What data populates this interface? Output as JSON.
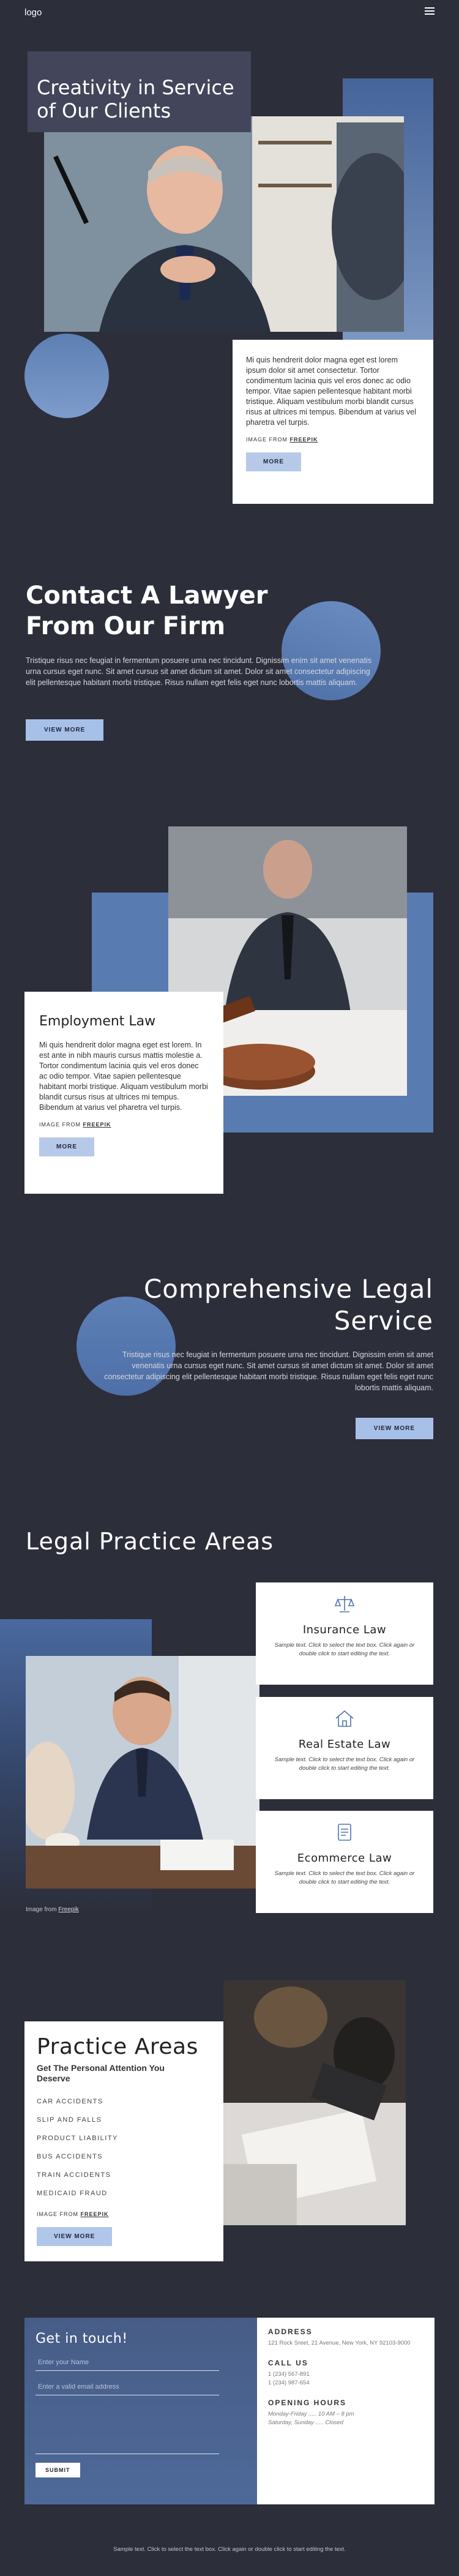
{
  "header": {
    "logo": "logo",
    "menu_icon": "hamburger-icon"
  },
  "hero": {
    "title": "Creativity in Service of Our Clients",
    "body": "Mi quis hendrerit dolor magna eget est lorem ipsum dolor sit amet consectetur. Tortor condimentum lacinia quis vel eros donec ac odio tempor. Vitae sapien pellentesque habitant morbi tristique. Aliquam vestibulum morbi blandit cursus risus at ultrices mi tempus. Bibendum at varius vel pharetra vel turpis.",
    "credit_prefix": "Image from",
    "credit_link": "Freepik",
    "button": "MORE"
  },
  "contact": {
    "title": "Contact A Lawyer From Our Firm",
    "body": "Tristique risus nec feugiat in fermentum posuere urna nec tincidunt. Dignissim enim sit amet venenatis urna cursus eget nunc. Sit amet cursus sit amet dictum sit amet. Dolor sit amet consectetur adipiscing elit pellentesque habitant morbi tristique. Risus nullam eget felis eget nunc lobortis mattis aliquam.",
    "button": "VIEW MORE"
  },
  "employment": {
    "title": "Employment Law",
    "body": "Mi quis hendrerit dolor magna eget est lorem. In est ante in nibh mauris cursus mattis molestie a. Tortor condimentum lacinia quis vel eros donec ac odio tempor. Vitae sapien pellentesque habitant morbi tristique. Aliquam vestibulum morbi blandit cursus risus at ultrices mi tempus. Bibendum at varius vel pharetra vel turpis.",
    "credit_prefix": "Image from",
    "credit_link": "Freepik",
    "button": "MORE"
  },
  "comprehensive": {
    "title": "Comprehensive Legal Service",
    "body": "Tristique risus nec feugiat in fermentum posuere urna nec tincidunt. Dignissim enim sit amet venenatis urna cursus eget nunc. Sit amet cursus sit amet dictum sit amet. Dolor sit amet consectetur adipiscing elit pellentesque habitant morbi tristique. Risus nullam eget felis eget nunc lobortis mattis aliquam.",
    "button": "VIEW MORE"
  },
  "legal_practice": {
    "title": "Legal Practice Areas",
    "cards": [
      {
        "icon": "scales-icon",
        "title": "Insurance Law",
        "text": "Sample text. Click to select the text box. Click again or double click to start editing the text."
      },
      {
        "icon": "house-icon",
        "title": "Real Estate Law",
        "text": "Sample text. Click to select the text box. Click again or double click to start editing the text."
      },
      {
        "icon": "cart-icon",
        "title": "Ecommerce Law",
        "text": "Sample text. Click to select the text box. Click again or double click to start editing the text."
      }
    ],
    "credit_prefix": "Image from",
    "credit_link": "Freepik"
  },
  "practice_areas": {
    "title": "Practice Areas",
    "subtitle": "Get The Personal Attention You Deserve",
    "items": [
      "CAR ACCIDENTS",
      "SLIP AND FALLS",
      "PRODUCT LIABILITY",
      "BUS ACCIDENTS",
      "TRAIN ACCIDENTS",
      "MEDICAID FRAUD"
    ],
    "credit_prefix": "Image from",
    "credit_link": "Freepik",
    "button": "VIEW MORE"
  },
  "contact_form": {
    "title": "Get in touch!",
    "name_placeholder": "Enter your Name",
    "email_placeholder": "Enter a valid email address",
    "submit": "SUBMIT"
  },
  "info": {
    "address_heading": "ADDRESS",
    "address": "121 Rock Sreet, 21 Avenue, New York, NY 92103-9000",
    "call_heading": "CALL US",
    "phones": "1 (234) 567-891\n1 (234) 987-654",
    "hours_heading": "OPENING HOURS",
    "hours": "Monday-Friday ..... 10 AM – 8 pm\nSaturday, Sunday ..... Closed"
  },
  "footer": {
    "text": "Sample text. Click to select the text box. Click again or double click to start editing the text."
  },
  "colors": {
    "background": "#2c2e3a",
    "accent_blue": "#587cb1",
    "button_light": "#b7c9e8"
  }
}
